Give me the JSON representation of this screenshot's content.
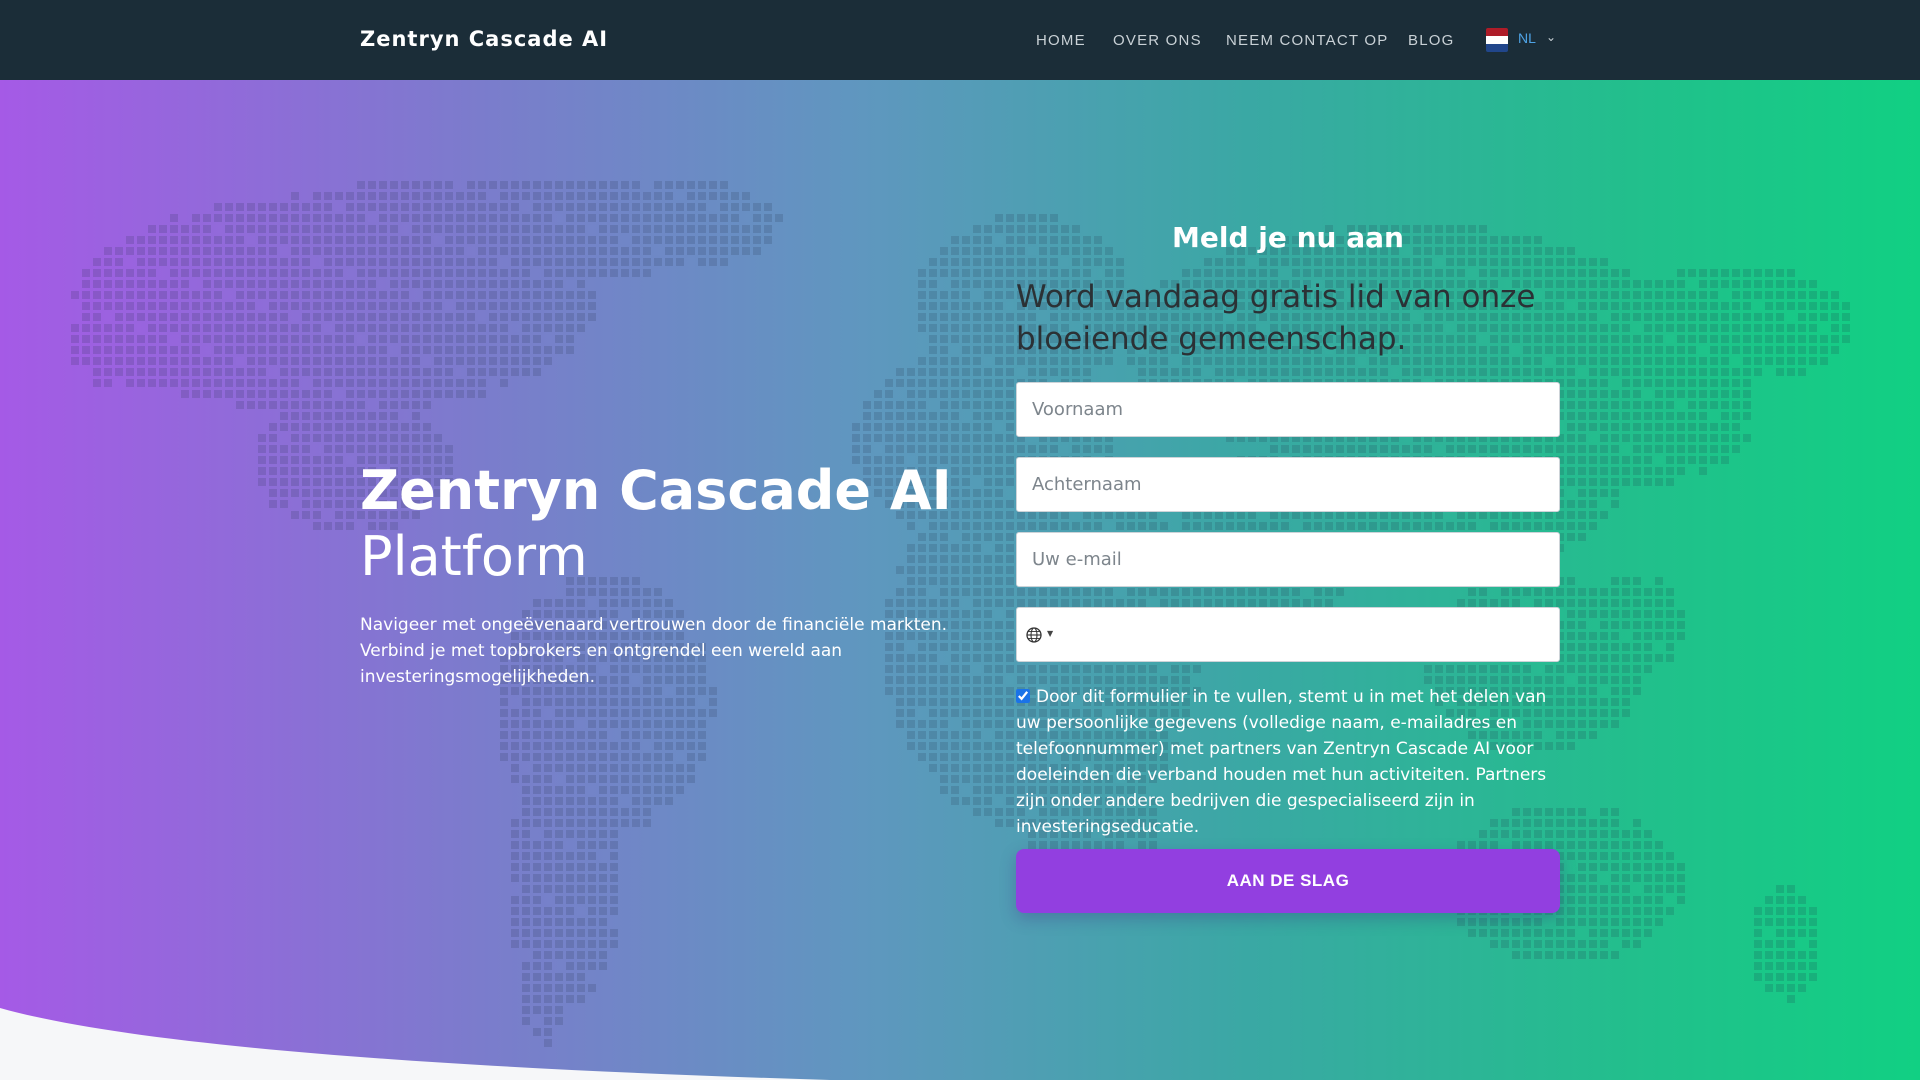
{
  "header": {
    "brand": "Zentryn Cascade AI",
    "nav": [
      "HOME",
      "OVER ONS",
      "NEEM CONTACT OP",
      "BLOG"
    ],
    "language": {
      "code": "NL",
      "flag_colors": [
        "#ae1c28",
        "#ffffff",
        "#21468b"
      ]
    }
  },
  "hero": {
    "title": "Zentryn Cascade AI",
    "subtitle": "Platform",
    "description": "Navigeer met ongeëvenaard vertrouwen door de financiële markten. Verbind je met topbrokers en ontgrendel een wereld aan investeringsmogelijkheden."
  },
  "form": {
    "heading": "Meld je nu aan",
    "lead": "Word vandaag gratis lid van onze bloeiende gemeenschap.",
    "first_name_placeholder": "Voornaam",
    "last_name_placeholder": "Achternaam",
    "email_placeholder": "Uw e-mail",
    "phone_value": "",
    "consent_checked": true,
    "consent_text": "Door dit formulier in te vullen, stemt u in met het delen van uw persoonlijke gegevens (volledige naam, e-mailadres en telefoonnummer) met partners van Zentryn Cascade AI voor doeleinden die verband houden met hun activiteiten. Partners zijn onder andere bedrijven die gespecialiseerd zijn in investeringseducatie.",
    "submit_label": "AAN DE SLAG"
  },
  "colors": {
    "navbar": "#1b2d38",
    "gradient_start": "#a55ae6",
    "gradient_end": "#11d083",
    "button": "#923fe0"
  }
}
